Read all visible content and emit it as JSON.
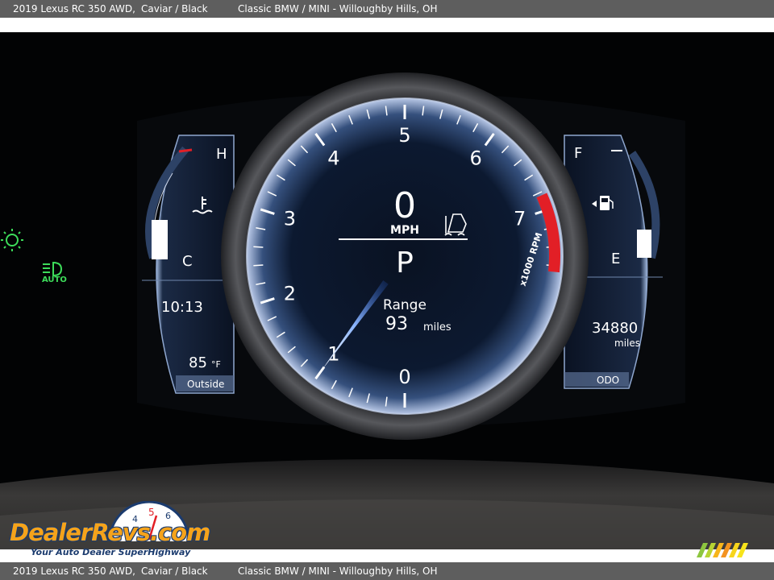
{
  "caption": {
    "car": "2019 Lexus RC 350 AWD,",
    "color": "Caviar / Black",
    "dealer": "Classic BMW / MINI - Willoughby Hills, OH"
  },
  "cluster": {
    "speed": "0",
    "speed_unit": "MPH",
    "gear": "P",
    "range_label": "Range",
    "range_value": "93",
    "range_unit": "miles",
    "clock": "10:13",
    "outside_temp": "85",
    "outside_unit": "°F",
    "outside_label": "Outside",
    "odometer": "34880",
    "odometer_unit": "miles",
    "odometer_label": "ODO",
    "temp_hot": "H",
    "temp_cold": "C",
    "fuel_full": "F",
    "fuel_empty": "E",
    "auto_label": "AUTO",
    "tach_unit": "x1000 RPM",
    "tach_numbers": [
      "0",
      "1",
      "2",
      "3",
      "4",
      "5",
      "6",
      "7"
    ],
    "rpm": 1.0,
    "redline_start": 7,
    "coolant_level": 0.35,
    "fuel_level": 0.25,
    "icons": [
      "exterior-light-icon",
      "auto-headlight-icon",
      "coolant-temp-icon",
      "fuel-pump-icon",
      "traction-control-icon"
    ],
    "colors": {
      "redline": "#e21f26",
      "needle": "#6ea6ff",
      "indicator": "#3ddc5a"
    }
  },
  "watermark": {
    "brand": "DealerRevs.com",
    "slogan": "Your Auto Dealer SuperHighway",
    "dial_digits": [
      "4",
      "5",
      "6"
    ]
  }
}
